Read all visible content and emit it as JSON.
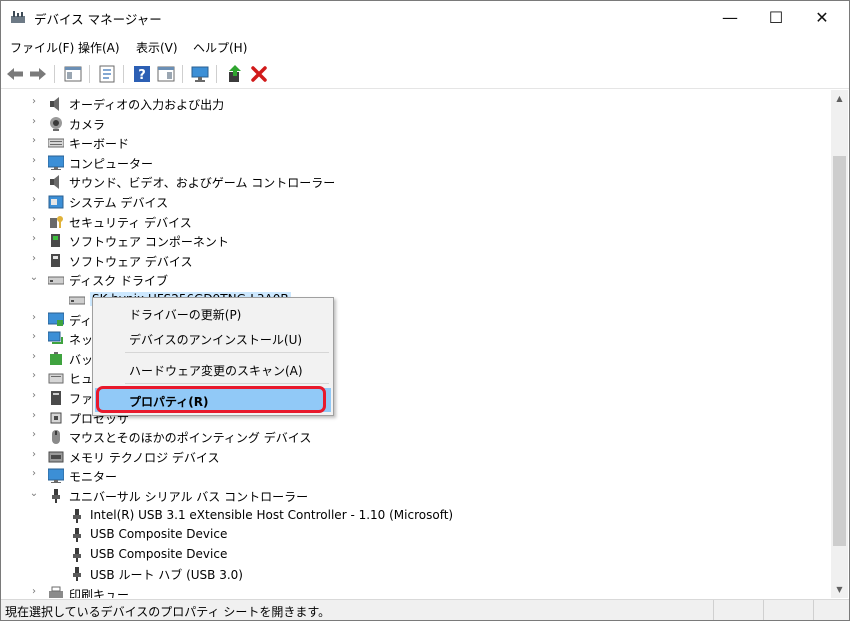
{
  "window": {
    "title": "デバイス マネージャー",
    "minimize": "—",
    "maximize": "☐",
    "close": "✕"
  },
  "menu": [
    "ファイル(F)",
    "操作(A)",
    "表示(V)",
    "ヘルプ(H)"
  ],
  "toolbar_icons": [
    "back-arrow-icon",
    "forward-arrow-icon",
    "show-hide-console-tree-icon",
    "properties-icon",
    "help-icon",
    "show-action-pane-icon",
    "scan-hardware-icon",
    "update-driver-icon",
    "uninstall-device-icon"
  ],
  "tree": [
    {
      "label": "オーディオの入力および出力",
      "icon": "speaker-icon",
      "expander": "collapsed",
      "indent": 0
    },
    {
      "label": "カメラ",
      "icon": "camera-icon",
      "expander": "collapsed",
      "indent": 0
    },
    {
      "label": "キーボード",
      "icon": "keyboard-icon",
      "expander": "collapsed",
      "indent": 0
    },
    {
      "label": "コンピューター",
      "icon": "monitor-icon",
      "expander": "collapsed",
      "indent": 0
    },
    {
      "label": "サウンド、ビデオ、およびゲーム コントローラー",
      "icon": "speaker-icon",
      "expander": "collapsed",
      "indent": 0
    },
    {
      "label": "システム デバイス",
      "icon": "system-device-icon",
      "expander": "collapsed",
      "indent": 0
    },
    {
      "label": "セキュリティ デバイス",
      "icon": "security-key-icon",
      "expander": "collapsed",
      "indent": 0
    },
    {
      "label": "ソフトウェア コンポーネント",
      "icon": "software-component-icon",
      "expander": "collapsed",
      "indent": 0
    },
    {
      "label": "ソフトウェア デバイス",
      "icon": "software-device-icon",
      "expander": "collapsed",
      "indent": 0
    },
    {
      "label": "ディスク ドライブ",
      "icon": "disk-drive-icon",
      "expander": "expanded",
      "indent": 0
    },
    {
      "label": "SK hynix HFS256GD9TNG-L3A0B",
      "icon": "disk-drive-icon",
      "expander": "none",
      "indent": 1,
      "selected": true
    },
    {
      "label": "ディスプレイ アダプター",
      "icon": "display-adapter-icon",
      "expander": "collapsed",
      "indent": 0
    },
    {
      "label": "ネットワーク アダプター",
      "icon": "network-adapter-icon",
      "expander": "collapsed",
      "indent": 0
    },
    {
      "label": "バッテリ",
      "icon": "battery-icon",
      "expander": "collapsed",
      "indent": 0
    },
    {
      "label": "ヒューマン インターフェイス デバイス",
      "icon": "hid-icon",
      "expander": "collapsed",
      "indent": 0
    },
    {
      "label": "ファームウェア",
      "icon": "firmware-icon",
      "expander": "collapsed",
      "indent": 0
    },
    {
      "label": "プロセッサ",
      "icon": "processor-icon",
      "expander": "collapsed",
      "indent": 0
    },
    {
      "label": "マウスとそのほかのポインティング デバイス",
      "icon": "mouse-icon",
      "expander": "collapsed",
      "indent": 0
    },
    {
      "label": "メモリ テクノロジ デバイス",
      "icon": "memory-icon",
      "expander": "collapsed",
      "indent": 0
    },
    {
      "label": "モニター",
      "icon": "monitor-icon",
      "expander": "collapsed",
      "indent": 0
    },
    {
      "label": "ユニバーサル シリアル バス コントローラー",
      "icon": "usb-icon",
      "expander": "expanded",
      "indent": 0
    },
    {
      "label": "Intel(R) USB 3.1 eXtensible Host Controller - 1.10 (Microsoft)",
      "icon": "usb-icon",
      "expander": "none",
      "indent": 1
    },
    {
      "label": "USB Composite Device",
      "icon": "usb-icon",
      "expander": "none",
      "indent": 1
    },
    {
      "label": "USB Composite Device",
      "icon": "usb-icon",
      "expander": "none",
      "indent": 1
    },
    {
      "label": "USB ルート ハブ (USB 3.0)",
      "icon": "usb-icon",
      "expander": "none",
      "indent": 1
    },
    {
      "label": "印刷キュー",
      "icon": "printer-icon",
      "expander": "collapsed",
      "indent": 0
    }
  ],
  "context_menu": {
    "update_driver": "ドライバーの更新(P)",
    "uninstall": "デバイスのアンインストール(U)",
    "scan": "ハードウェア変更のスキャン(A)",
    "properties": "プロパティ(R)"
  },
  "status": {
    "text": "現在選択しているデバイスのプロパティ シートを開きます。"
  },
  "colors": {
    "highlight": "#91c9f7",
    "selection": "#cce8ff",
    "annotation_ring": "#e8192c"
  }
}
